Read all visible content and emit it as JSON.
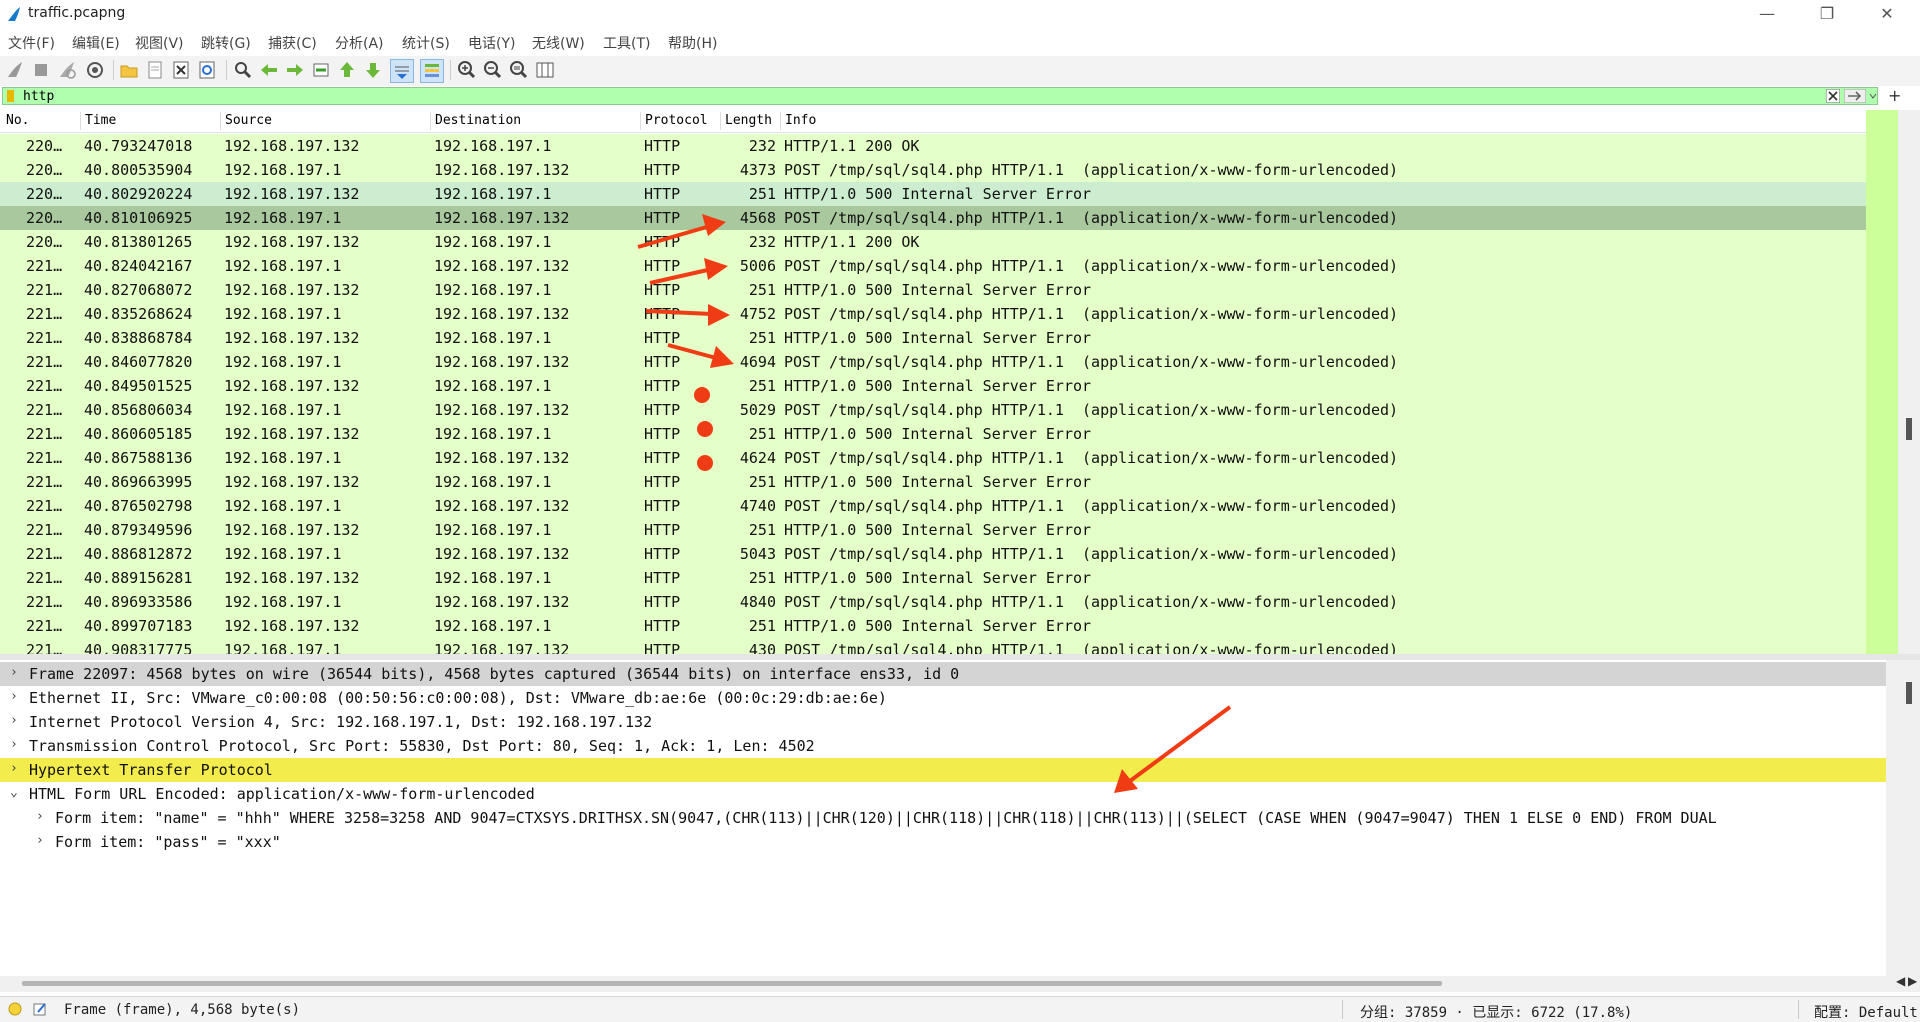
{
  "window": {
    "title": "traffic.pcapng",
    "minimize": "—",
    "restore": "❐",
    "close": "✕"
  },
  "menu": [
    "文件(F)",
    "编辑(E)",
    "视图(V)",
    "跳转(G)",
    "捕获(C)",
    "分析(A)",
    "统计(S)",
    "电话(Y)",
    "无线(W)",
    "工具(T)",
    "帮助(H)"
  ],
  "filter": {
    "value": "http"
  },
  "columns": [
    "No.",
    "Time",
    "Source",
    "Destination",
    "Protocol",
    "Length",
    "Info"
  ],
  "packets": [
    {
      "no": "220…",
      "time": "40.793247018",
      "src": "192.168.197.132",
      "dst": "192.168.197.1",
      "proto": "HTTP",
      "len": "232",
      "info": "HTTP/1.1 200 OK"
    },
    {
      "no": "220…",
      "time": "40.800535904",
      "src": "192.168.197.1",
      "dst": "192.168.197.132",
      "proto": "HTTP",
      "len": "4373",
      "info": "POST /tmp/sql/sql4.php HTTP/1.1  (application/x-www-form-urlencoded)"
    },
    {
      "no": "220…",
      "time": "40.802920224",
      "src": "192.168.197.132",
      "dst": "192.168.197.1",
      "proto": "HTTP",
      "len": "251",
      "info": "HTTP/1.0 500 Internal Server Error"
    },
    {
      "no": "220…",
      "time": "40.810106925",
      "src": "192.168.197.1",
      "dst": "192.168.197.132",
      "proto": "HTTP",
      "len": "4568",
      "info": "POST /tmp/sql/sql4.php HTTP/1.1  (application/x-www-form-urlencoded)"
    },
    {
      "no": "220…",
      "time": "40.813801265",
      "src": "192.168.197.132",
      "dst": "192.168.197.1",
      "proto": "HTTP",
      "len": "232",
      "info": "HTTP/1.1 200 OK"
    },
    {
      "no": "221…",
      "time": "40.824042167",
      "src": "192.168.197.1",
      "dst": "192.168.197.132",
      "proto": "HTTP",
      "len": "5006",
      "info": "POST /tmp/sql/sql4.php HTTP/1.1  (application/x-www-form-urlencoded)"
    },
    {
      "no": "221…",
      "time": "40.827068072",
      "src": "192.168.197.132",
      "dst": "192.168.197.1",
      "proto": "HTTP",
      "len": "251",
      "info": "HTTP/1.0 500 Internal Server Error"
    },
    {
      "no": "221…",
      "time": "40.835268624",
      "src": "192.168.197.1",
      "dst": "192.168.197.132",
      "proto": "HTTP",
      "len": "4752",
      "info": "POST /tmp/sql/sql4.php HTTP/1.1  (application/x-www-form-urlencoded)"
    },
    {
      "no": "221…",
      "time": "40.838868784",
      "src": "192.168.197.132",
      "dst": "192.168.197.1",
      "proto": "HTTP",
      "len": "251",
      "info": "HTTP/1.0 500 Internal Server Error"
    },
    {
      "no": "221…",
      "time": "40.846077820",
      "src": "192.168.197.1",
      "dst": "192.168.197.132",
      "proto": "HTTP",
      "len": "4694",
      "info": "POST /tmp/sql/sql4.php HTTP/1.1  (application/x-www-form-urlencoded)"
    },
    {
      "no": "221…",
      "time": "40.849501525",
      "src": "192.168.197.132",
      "dst": "192.168.197.1",
      "proto": "HTTP",
      "len": "251",
      "info": "HTTP/1.0 500 Internal Server Error"
    },
    {
      "no": "221…",
      "time": "40.856806034",
      "src": "192.168.197.1",
      "dst": "192.168.197.132",
      "proto": "HTTP",
      "len": "5029",
      "info": "POST /tmp/sql/sql4.php HTTP/1.1  (application/x-www-form-urlencoded)"
    },
    {
      "no": "221…",
      "time": "40.860605185",
      "src": "192.168.197.132",
      "dst": "192.168.197.1",
      "proto": "HTTP",
      "len": "251",
      "info": "HTTP/1.0 500 Internal Server Error"
    },
    {
      "no": "221…",
      "time": "40.867588136",
      "src": "192.168.197.1",
      "dst": "192.168.197.132",
      "proto": "HTTP",
      "len": "4624",
      "info": "POST /tmp/sql/sql4.php HTTP/1.1  (application/x-www-form-urlencoded)"
    },
    {
      "no": "221…",
      "time": "40.869663995",
      "src": "192.168.197.132",
      "dst": "192.168.197.1",
      "proto": "HTTP",
      "len": "251",
      "info": "HTTP/1.0 500 Internal Server Error"
    },
    {
      "no": "221…",
      "time": "40.876502798",
      "src": "192.168.197.1",
      "dst": "192.168.197.132",
      "proto": "HTTP",
      "len": "4740",
      "info": "POST /tmp/sql/sql4.php HTTP/1.1  (application/x-www-form-urlencoded)"
    },
    {
      "no": "221…",
      "time": "40.879349596",
      "src": "192.168.197.132",
      "dst": "192.168.197.1",
      "proto": "HTTP",
      "len": "251",
      "info": "HTTP/1.0 500 Internal Server Error"
    },
    {
      "no": "221…",
      "time": "40.886812872",
      "src": "192.168.197.1",
      "dst": "192.168.197.132",
      "proto": "HTTP",
      "len": "5043",
      "info": "POST /tmp/sql/sql4.php HTTP/1.1  (application/x-www-form-urlencoded)"
    },
    {
      "no": "221…",
      "time": "40.889156281",
      "src": "192.168.197.132",
      "dst": "192.168.197.1",
      "proto": "HTTP",
      "len": "251",
      "info": "HTTP/1.0 500 Internal Server Error"
    },
    {
      "no": "221…",
      "time": "40.896933586",
      "src": "192.168.197.1",
      "dst": "192.168.197.132",
      "proto": "HTTP",
      "len": "4840",
      "info": "POST /tmp/sql/sql4.php HTTP/1.1  (application/x-www-form-urlencoded)"
    },
    {
      "no": "221…",
      "time": "40.899707183",
      "src": "192.168.197.132",
      "dst": "192.168.197.1",
      "proto": "HTTP",
      "len": "251",
      "info": "HTTP/1.0 500 Internal Server Error"
    },
    {
      "no": "221…",
      "time": "40.908317775",
      "src": "192.168.197.1",
      "dst": "192.168.197.132",
      "proto": "HTTP",
      "len": "430",
      "info": "POST /tmp/sql/sql4.php HTTP/1.1  (application/x-www-form-urlencoded)"
    }
  ],
  "selected_packet_index": 3,
  "details": [
    {
      "chev": "›",
      "indent": 0,
      "text": "Frame 22097: 4568 bytes on wire (36544 bits), 4568 bytes captured (36544 bits) on interface ens33, id 0",
      "style": "grey"
    },
    {
      "chev": "›",
      "indent": 0,
      "text": "Ethernet II, Src: VMware_c0:00:08 (00:50:56:c0:00:08), Dst: VMware_db:ae:6e (00:0c:29:db:ae:6e)",
      "style": ""
    },
    {
      "chev": "›",
      "indent": 0,
      "text": "Internet Protocol Version 4, Src: 192.168.197.1, Dst: 192.168.197.132",
      "style": ""
    },
    {
      "chev": "›",
      "indent": 0,
      "text": "Transmission Control Protocol, Src Port: 55830, Dst Port: 80, Seq: 1, Ack: 1, Len: 4502",
      "style": ""
    },
    {
      "chev": "›",
      "indent": 0,
      "text": "Hypertext Transfer Protocol",
      "style": "yellow"
    },
    {
      "chev": "⌄",
      "indent": 0,
      "text": "HTML Form URL Encoded: application/x-www-form-urlencoded",
      "style": ""
    },
    {
      "chev": "›",
      "indent": 1,
      "text": "Form item: \"name\" = \"hhh\" WHERE 3258=3258 AND 9047=CTXSYS.DRITHSX.SN(9047,(CHR(113)||CHR(120)||CHR(118)||CHR(118)||CHR(113)||(SELECT (CASE WHEN (9047=9047) THEN 1 ELSE 0 END) FROM DUAL",
      "style": ""
    },
    {
      "chev": "›",
      "indent": 1,
      "text": "Form item: \"pass\" = \"xxx\"",
      "style": ""
    }
  ],
  "status": {
    "frame_info": "Frame (frame), 4,568 byte(s)",
    "counts": "分组: 37859 · 已显示: 6722 (17.8%)",
    "profile": "配置: Default"
  },
  "colors": {
    "row_bg": "#e4ffc7",
    "row_selected": "#a9c89d",
    "filter_bg": "#afffaf",
    "annotation": "#f03c14"
  }
}
